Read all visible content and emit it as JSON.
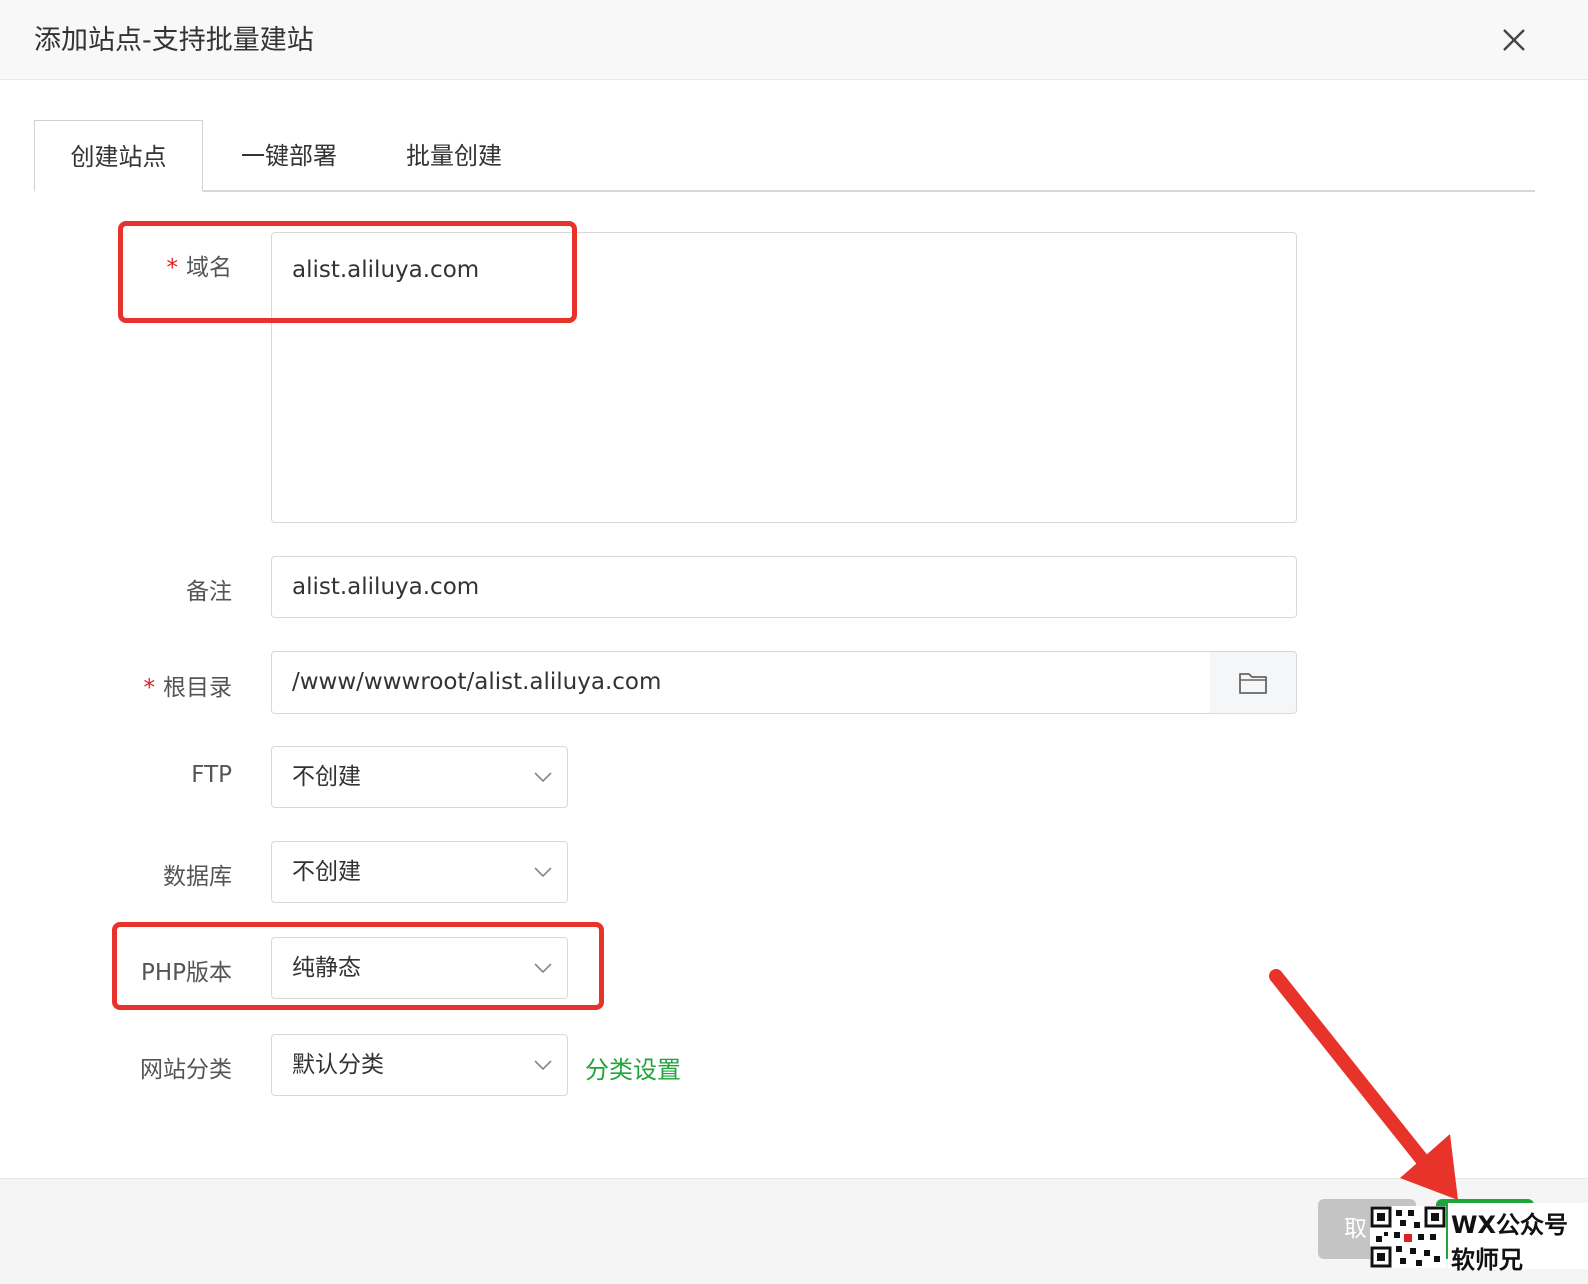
{
  "dialog": {
    "title": "添加站点-支持批量建站",
    "close_icon": "close-icon"
  },
  "tabs": [
    {
      "label": "创建站点",
      "active": true
    },
    {
      "label": "一键部署",
      "active": false
    },
    {
      "label": "批量创建",
      "active": false
    }
  ],
  "form": {
    "domain": {
      "label": "域名",
      "required_mark": "*",
      "value": "alist.aliluya.com"
    },
    "remark": {
      "label": "备注",
      "value": "alist.aliluya.com"
    },
    "root": {
      "label": "根目录",
      "required_mark": "*",
      "value": "/www/wwwroot/alist.aliluya.com",
      "icon": "folder-icon"
    },
    "ftp": {
      "label": "FTP",
      "value": "不创建"
    },
    "database": {
      "label": "数据库",
      "value": "不创建"
    },
    "php": {
      "label": "PHP版本",
      "value": "纯静态"
    },
    "category": {
      "label": "网站分类",
      "value": "默认分类",
      "link": "分类设置"
    }
  },
  "footer": {
    "cancel_label": "取"
  },
  "watermark": {
    "line1": "WX公众号",
    "line2": "软师兄"
  },
  "colors": {
    "accent": "#20a53a",
    "highlight": "#e8332a",
    "required": "#e02020"
  }
}
